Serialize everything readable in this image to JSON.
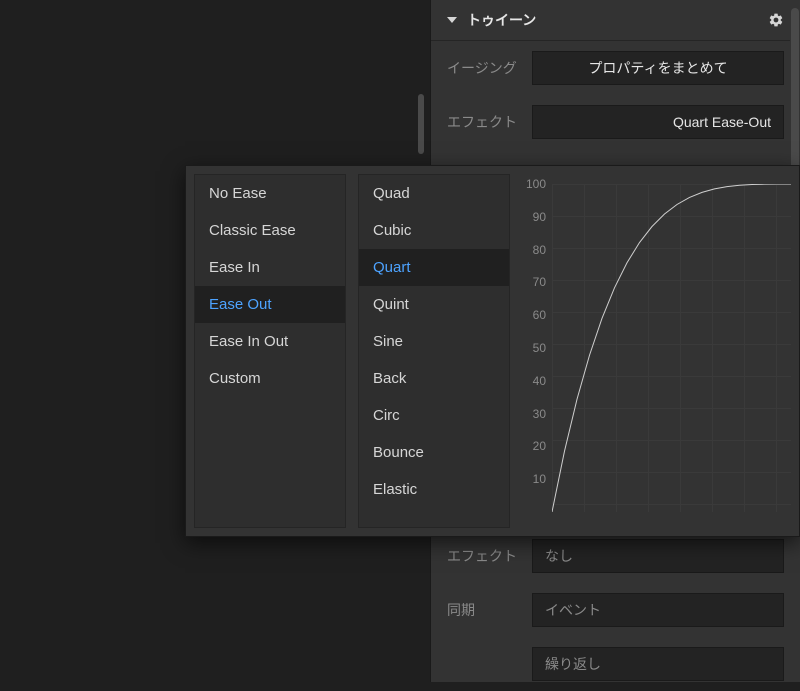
{
  "section": {
    "title": "トゥイーン"
  },
  "rows": {
    "easing": {
      "label": "イージング",
      "value": "プロパティをまとめて"
    },
    "effect_top": {
      "label": "エフェクト",
      "value": "Quart Ease-Out"
    },
    "effect_bottom": {
      "label": "エフェクト",
      "value": "なし"
    },
    "sync": {
      "label": "同期",
      "value": "イベント"
    },
    "repeat": {
      "value": "繰り返し"
    }
  },
  "ease_categories": [
    {
      "label": "No Ease",
      "selected": false
    },
    {
      "label": "Classic Ease",
      "selected": false
    },
    {
      "label": "Ease In",
      "selected": false
    },
    {
      "label": "Ease Out",
      "selected": true
    },
    {
      "label": "Ease In Out",
      "selected": false
    },
    {
      "label": "Custom",
      "selected": false
    }
  ],
  "ease_functions": [
    {
      "label": "Quad",
      "selected": false
    },
    {
      "label": "Cubic",
      "selected": false
    },
    {
      "label": "Quart",
      "selected": true
    },
    {
      "label": "Quint",
      "selected": false
    },
    {
      "label": "Sine",
      "selected": false
    },
    {
      "label": "Back",
      "selected": false
    },
    {
      "label": "Circ",
      "selected": false
    },
    {
      "label": "Bounce",
      "selected": false
    },
    {
      "label": "Elastic",
      "selected": false
    }
  ],
  "chart_data": {
    "type": "line",
    "title": "",
    "xlabel": "",
    "ylabel": "",
    "ylim": [
      0,
      100
    ],
    "y_ticks": [
      100,
      90,
      80,
      70,
      60,
      50,
      40,
      30,
      20,
      10
    ],
    "curve": "Quart Ease-Out",
    "series": [
      {
        "name": "Quart Ease-Out",
        "x": [
          0,
          0.05,
          0.1,
          0.15,
          0.2,
          0.25,
          0.3,
          0.35,
          0.4,
          0.45,
          0.5,
          0.55,
          0.6,
          0.65,
          0.7,
          0.75,
          0.8,
          0.85,
          0.9,
          0.95,
          1.0
        ],
        "y": [
          0,
          18.55,
          34.39,
          47.8,
          59.04,
          68.36,
          75.99,
          82.15,
          87.04,
          90.85,
          93.75,
          95.9,
          97.44,
          98.5,
          99.19,
          99.61,
          99.84,
          99.95,
          99.99,
          100.0,
          100.0
        ]
      }
    ]
  }
}
